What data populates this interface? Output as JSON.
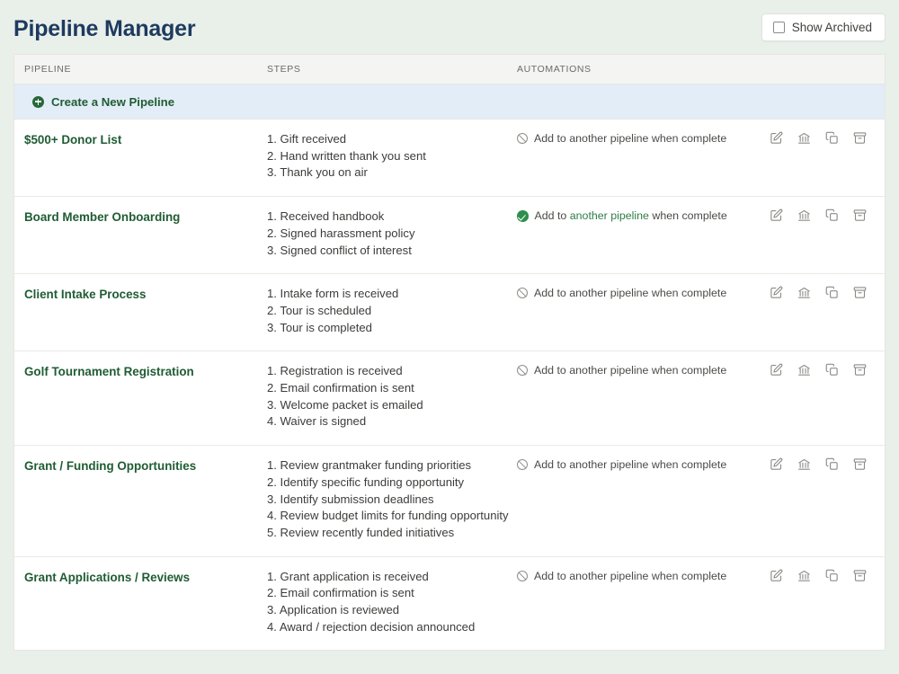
{
  "header": {
    "title": "Pipeline Manager",
    "show_archived_label": "Show Archived",
    "show_archived_checked": false
  },
  "table": {
    "columns": {
      "pipeline": "PIPELINE",
      "steps": "STEPS",
      "automations": "AUTOMATIONS"
    },
    "create_row": {
      "label": "Create a New Pipeline",
      "icon": "plus-circle-icon"
    },
    "row_actions": [
      {
        "name": "edit-pipeline-button",
        "icon": "edit-pencil-icon"
      },
      {
        "name": "bank-pipeline-button",
        "icon": "bank-icon"
      },
      {
        "name": "duplicate-pipeline-button",
        "icon": "copy-icon"
      },
      {
        "name": "archive-pipeline-button",
        "icon": "archive-box-icon"
      }
    ],
    "rows": [
      {
        "name": "$500+ Donor List",
        "steps": [
          "1. Gift received",
          "2. Hand written thank you sent",
          "3. Thank you on air"
        ],
        "automation": {
          "status": "disabled",
          "icon": "prohibited-icon",
          "text_before": "Add to ",
          "text_link": "another pipeline",
          "text_after": " when complete",
          "full_text": "Add to another pipeline when complete"
        }
      },
      {
        "name": "Board Member Onboarding",
        "steps": [
          "1. Received handbook",
          "2. Signed harassment policy",
          "3. Signed conflict of interest"
        ],
        "automation": {
          "status": "enabled",
          "icon": "check-circle-icon",
          "text_before": "Add to ",
          "text_link": "another pipeline",
          "text_after": " when complete",
          "full_text": "Add to another pipeline when complete"
        }
      },
      {
        "name": "Client Intake Process",
        "steps": [
          "1. Intake form is received",
          "2. Tour is scheduled",
          "3. Tour is completed"
        ],
        "automation": {
          "status": "disabled",
          "icon": "prohibited-icon",
          "text_before": "Add to ",
          "text_link": "another pipeline",
          "text_after": " when complete",
          "full_text": "Add to another pipeline when complete"
        }
      },
      {
        "name": "Golf Tournament Registration",
        "steps": [
          "1. Registration is received",
          "2. Email confirmation is sent",
          "3. Welcome packet is emailed",
          "4. Waiver is signed"
        ],
        "automation": {
          "status": "disabled",
          "icon": "prohibited-icon",
          "text_before": "Add to ",
          "text_link": "another pipeline",
          "text_after": " when complete",
          "full_text": "Add to another pipeline when complete"
        }
      },
      {
        "name": "Grant / Funding Opportunities",
        "steps": [
          "1. Review grantmaker funding priorities",
          "2. Identify specific funding opportunity",
          "3. Identify submission deadlines",
          "4. Review budget limits for funding opportunity",
          "5. Review recently funded initiatives"
        ],
        "automation": {
          "status": "disabled",
          "icon": "prohibited-icon",
          "text_before": "Add to ",
          "text_link": "another pipeline",
          "text_after": " when complete",
          "full_text": "Add to another pipeline when complete"
        }
      },
      {
        "name": "Grant Applications / Reviews",
        "steps": [
          "1. Grant application is received",
          "2. Email confirmation is sent",
          "3. Application is reviewed",
          "4. Award / rejection decision announced"
        ],
        "automation": {
          "status": "disabled",
          "icon": "prohibited-icon",
          "text_before": "Add to ",
          "text_link": "another pipeline",
          "text_after": " when complete",
          "full_text": "Add to another pipeline when complete"
        }
      }
    ]
  },
  "colors": {
    "page_background": "#e9efe9",
    "title": "#1e3a5f",
    "pipeline_name": "#1f5c33",
    "create_row_background": "#e3edf7",
    "header_row_background": "#f4f4f2",
    "automation_enabled": "#2f8f4e",
    "automation_disabled": "#8e8e8a"
  }
}
